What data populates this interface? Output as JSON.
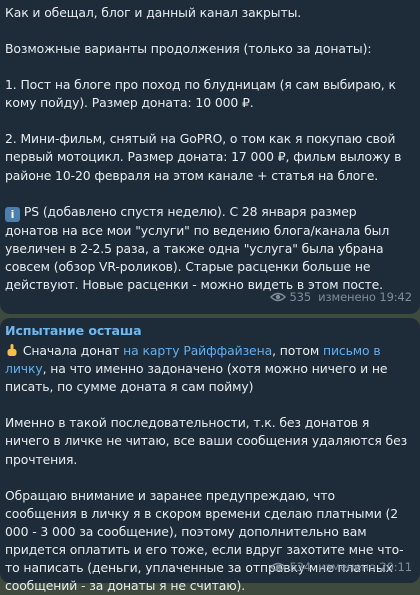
{
  "post1": {
    "p0": "Как и обещал, блог и данный канал закрыты.",
    "p1": "Возможные варианты продолжения (только за донаты):",
    "p2": "1. Пост на блоге про поход по блудницам (я сам выбираю, к кому пойду). Размер доната: 10 000 ₽.",
    "p3": "2. Мини-фильм, снятый на GoPRO, о том как я покупаю свой первый мотоцикл. Размер доната: 17 000 ₽, фильм выложу в районе 10-20 февраля на этом канале + статья на блоге.",
    "p4": "PS (добавлено спустя неделю). С 28 января размер донатов на все мои \"услуги\" по ведению блога/канала был увеличен в 2-2.5 раза, а также одна \"услуга\" была убрана совсем (обзор VR-роликов). Старые расценки больше не действуют. Новые расценки - можно видеть в этом посте.",
    "views": "535",
    "edited": "изменено 19:42"
  },
  "post2": {
    "sender": "Испытание осташа",
    "p1_a": "Сначала донат ",
    "p1_link1": "на карту Райффайзена",
    "p1_b": ", потом ",
    "p1_link2": "письмо в личку",
    "p1_c": ", на что именно задоначено (хотя можно ничего и не писать, по сумме доната я сам пойму)",
    "p2": "Именно в такой последовательности, т.к. без донатов я ничего в личке не читаю, все ваши сообщения удаляются без прочтения.",
    "p3": "Обращаю внимание и заранее предупреждаю, что сообщения в личку я в скором времени сделаю платными (2 000 - 3 000 за сообщение), поэтому дополнительно вам придется оплатить и его тоже, если вдруг захотите мне что-то написать (деньги, уплаченные за отправку мне платных сообщений - за донаты я не считаю).",
    "views": "534",
    "edited": "изменено 20:11"
  },
  "icons": {
    "info": "information-icon",
    "hand": "pointing-hand-icon",
    "views": "eye-icon"
  }
}
